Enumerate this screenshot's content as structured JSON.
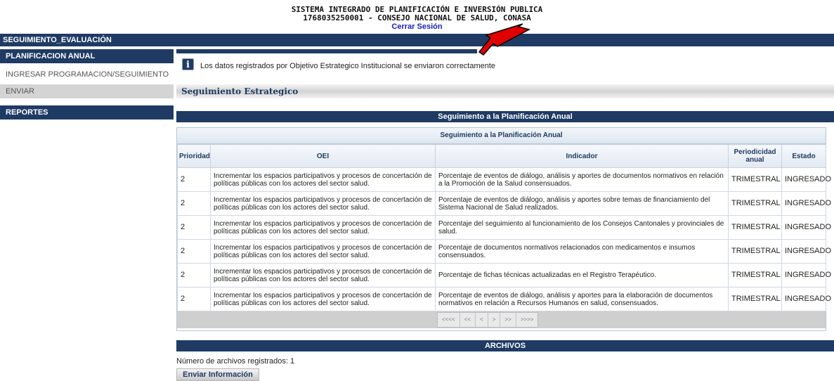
{
  "header": {
    "title_line1": "SISTEMA INTEGRADO DE PLANIFICACIÓN E INVERSIÓN PUBLICA",
    "title_line2": "1768035250001 - CONSEJO NACIONAL DE SALUD, CONASA",
    "logout_label": "Cerrar Sesión"
  },
  "topbar": {
    "label": "SEGUIMIENTO_EVALUACIÓN"
  },
  "sidebar": {
    "section_planificacion": "PLANIFICACION ANUAL",
    "items": [
      {
        "label": "INGRESAR PROGRAMACION/SEGUIMIENTO"
      },
      {
        "label": "ENVIAR"
      }
    ],
    "section_reportes": "REPORTES"
  },
  "notice": {
    "icon": "info-icon",
    "message": "Los datos registrados por Objetivo Estrategico Institucional se enviaron correctamente"
  },
  "annotation": {
    "arrow_color": "#e00000"
  },
  "section_title": "Seguimiento Estrategico",
  "band_title": "Seguimiento a la Planificación Anual",
  "grid": {
    "caption": "Seguimiento a la Planificación Anual",
    "columns": {
      "prioridad": "Prioridad",
      "oei": "OEI",
      "indicador": "Indicador",
      "periodicidad": "Periodicidad anual",
      "estado": "Estado"
    },
    "rows": [
      {
        "prioridad": "2",
        "oei": "Incrementar los espacios participativos y procesos de concertación de políticas públicas con los actores del sector salud.",
        "indicador": "Porcentaje de eventos de diálogo, análisis y aportes de documentos normativos en relación a la Promoción de la Salud consensuados.",
        "periodicidad": "TRIMESTRAL",
        "estado": "INGRESADO"
      },
      {
        "prioridad": "2",
        "oei": "Incrementar los espacios participativos y procesos de concertación de políticas públicas con los actores del sector salud.",
        "indicador": "Porcentaje de eventos de diálogo, análisis y aportes sobre temas de financiamiento del Sistema Nacional de Salud realizados.",
        "periodicidad": "TRIMESTRAL",
        "estado": "INGRESADO"
      },
      {
        "prioridad": "2",
        "oei": "Incrementar los espacios participativos y procesos de concertación de políticas públicas con los actores del sector salud.",
        "indicador": "Porcentaje del seguimiento al funcionamiento de los Consejos Cantonales y provinciales de salud.",
        "periodicidad": "TRIMESTRAL",
        "estado": "INGRESADO"
      },
      {
        "prioridad": "2",
        "oei": "Incrementar los espacios participativos y procesos de concertación de políticas públicas con los actores del sector salud.",
        "indicador": "Porcentaje de documentos normativos relacionados con medicamentos e insumos consensuados.",
        "periodicidad": "TRIMESTRAL",
        "estado": "INGRESADO"
      },
      {
        "prioridad": "2",
        "oei": "Incrementar los espacios participativos y procesos de concertación de políticas públicas con los actores del sector salud.",
        "indicador": "Porcentaje de fichas técnicas actualizadas en el Registro Terapéutico.",
        "periodicidad": "TRIMESTRAL",
        "estado": "INGRESADO"
      },
      {
        "prioridad": "2",
        "oei": "Incrementar los espacios participativos y procesos de concertación de políticas públicas con los actores del sector salud.",
        "indicador": "Porcentaje de eventos de diálogo, análisis y aportes para la elaboración de documentos normativos en relación a Recursos Humanos en salud, consensuados.",
        "periodicidad": "TRIMESTRAL",
        "estado": "INGRESADO"
      }
    ],
    "pager": {
      "first": "<<<<",
      "prev_page": "<<",
      "prev": "<",
      "next": ">",
      "next_page": ">>",
      "last": ">>>>"
    }
  },
  "archivos": {
    "title": "ARCHIVOS",
    "count_text": "Número de archivos registrados: 1",
    "send_label": "Enviar Información"
  }
}
